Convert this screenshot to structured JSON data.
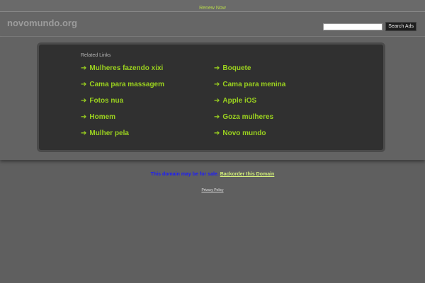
{
  "topbar": {
    "renew_label": "Renew Now"
  },
  "header": {
    "site_title": "novomundo.org",
    "search_placeholder": "",
    "search_value": "",
    "search_button_label": "Search Ads"
  },
  "related": {
    "heading": "Related Links",
    "left_links": [
      {
        "label": "Mulheres fazendo xixi"
      },
      {
        "label": "Cama para massagem"
      },
      {
        "label": "Fotos nua"
      },
      {
        "label": "Homem"
      },
      {
        "label": "Mulher pela"
      }
    ],
    "right_links": [
      {
        "label": "Boquete"
      },
      {
        "label": "Cama para menina"
      },
      {
        "label": "Apple iOS"
      },
      {
        "label": "Goza mulheres"
      },
      {
        "label": "Novo mundo"
      }
    ],
    "arrow_glyph": "➔"
  },
  "footer": {
    "sale_text": "This domain may be for sale.",
    "backorder_label": "Backorder this Domain",
    "privacy_label": "Privacy Policy"
  },
  "colors": {
    "link_green": "#9bd21f",
    "sale_blue": "#1a1aff",
    "background": "#5f5f5f",
    "panel": "#303030"
  }
}
